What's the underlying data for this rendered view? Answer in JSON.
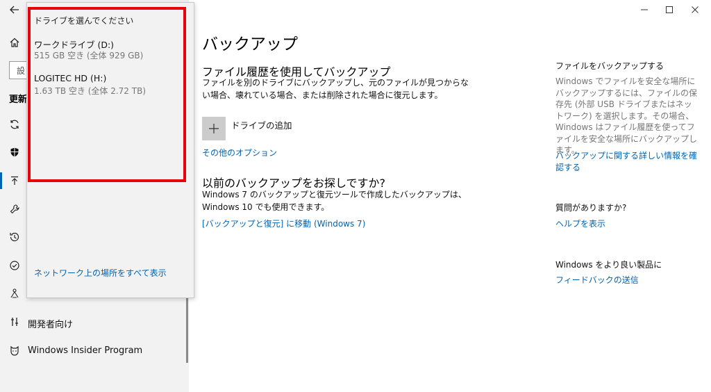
{
  "sidebar": {
    "search_placeholder": "設",
    "section_label": "更新",
    "items": [
      {
        "label": "開発者向け",
        "icon": "developer-icon"
      },
      {
        "label": "Windows Insider Program",
        "icon": "insider-icon"
      }
    ],
    "icons": [
      "back-arrow-icon",
      "home-icon",
      "sync-icon",
      "shield-icon",
      "backup-icon",
      "wrench-icon",
      "history-icon",
      "check-circle-icon",
      "person-icon"
    ]
  },
  "flyout": {
    "title": "ドライブを選んでください",
    "drives": [
      {
        "name": "ワークドライブ (D:)",
        "space": "515 GB 空き (全体 929 GB)"
      },
      {
        "name": "LOGITEC HD (H:)",
        "space": "1.63 TB 空き (全体 2.72 TB)"
      }
    ],
    "network_link": "ネットワーク上の場所をすべて表示"
  },
  "main": {
    "title": "バックアップ",
    "file_history_heading": "ファイル履歴を使用してバックアップ",
    "file_history_desc": "ファイルを別のドライブにバックアップし、元のファイルが見つからない場合、壊れている場合、または削除された場合に復元します。",
    "add_drive_label": "ドライブの追加",
    "other_options_link": "その他のオプション",
    "older_heading": "以前のバックアップをお探しですか?",
    "older_desc": "Windows 7 のバックアップと復元ツールで作成したバックアップは、Windows 10 でも使用できます。",
    "older_link": "[バックアップと復元] に移動 (Windows 7)"
  },
  "right": {
    "backup_heading": "ファイルをバックアップする",
    "backup_desc": "Windows でファイルを安全な場所にバックアップするには、ファイルの保存先 (外部 USB ドライブまたはネットワーク) を選択します。その場合、Windows はファイル履歴を使ってファイルを安全な場所にバックアップします。",
    "backup_link": "バックアップに関する詳しい情報を確認する",
    "question_heading": "質問がありますか?",
    "help_link": "ヘルプを表示",
    "improve_heading": "Windows をより良い製品に",
    "feedback_link": "フィードバックの送信"
  },
  "colors": {
    "accent": "#0063b1",
    "highlight_box": "#e8000b"
  }
}
